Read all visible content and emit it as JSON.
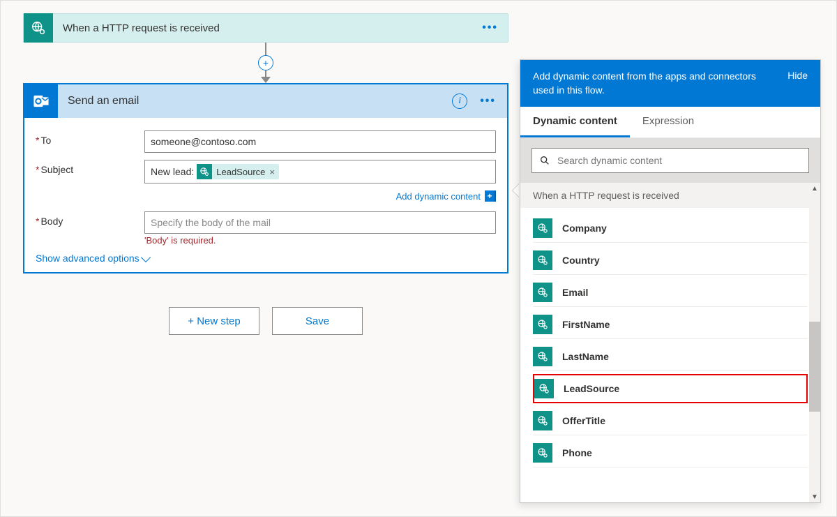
{
  "trigger": {
    "title": "When a HTTP request is received",
    "icon": "globe-gear-icon"
  },
  "action": {
    "title": "Send an email",
    "icon": "outlook-icon",
    "fields": {
      "to": {
        "label": "To",
        "value": "someone@contoso.com",
        "required": true
      },
      "subject": {
        "label": "Subject",
        "value": "New lead:",
        "required": true,
        "token": {
          "label": "LeadSource",
          "icon": "globe-gear-icon"
        }
      },
      "body": {
        "label": "Body",
        "placeholder": "Specify the body of the mail",
        "error": "'Body' is required.",
        "required": true
      }
    },
    "add_dc_label": "Add dynamic content",
    "show_adv_label": "Show advanced options"
  },
  "buttons": {
    "new_step": "+ New step",
    "save": "Save"
  },
  "dc_panel": {
    "description": "Add dynamic content from the apps and connectors used in this flow.",
    "hide_label": "Hide",
    "tabs": {
      "dynamic": "Dynamic content",
      "expression": "Expression"
    },
    "search_placeholder": "Search dynamic content",
    "group_title": "When a HTTP request is received",
    "items": [
      {
        "name": "Company"
      },
      {
        "name": "Country"
      },
      {
        "name": "Email"
      },
      {
        "name": "FirstName"
      },
      {
        "name": "LastName"
      },
      {
        "name": "LeadSource",
        "highlight": true
      },
      {
        "name": "OfferTitle"
      },
      {
        "name": "Phone"
      }
    ]
  }
}
